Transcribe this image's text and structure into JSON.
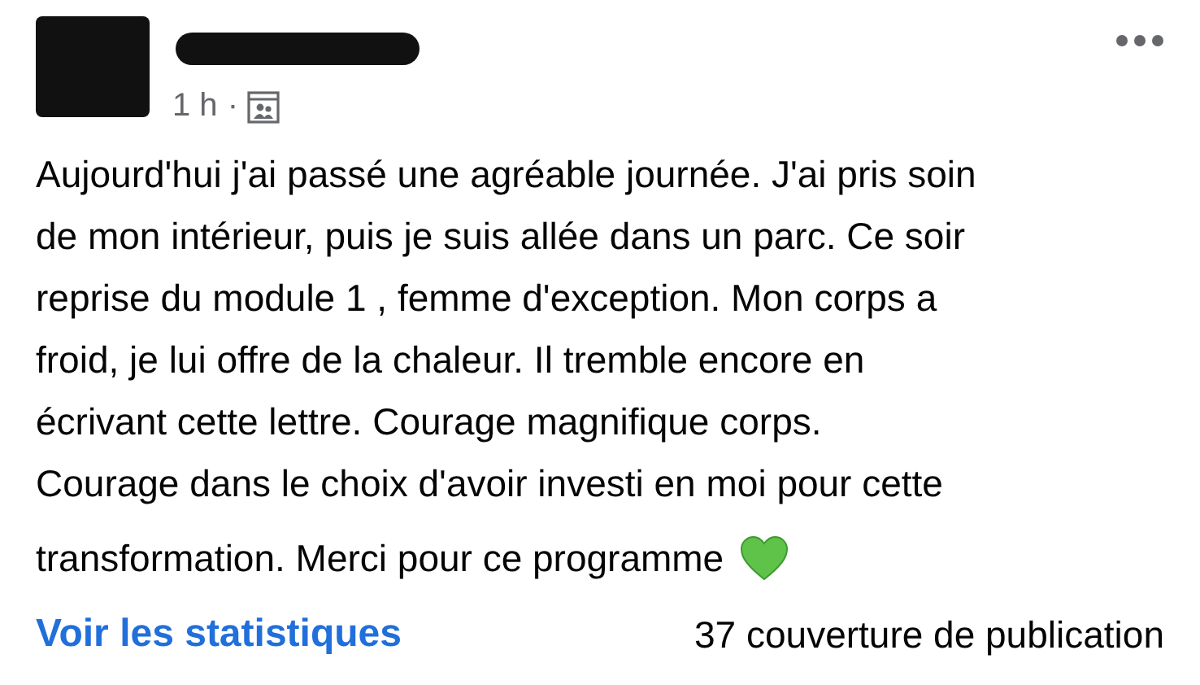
{
  "post": {
    "time": "1 h",
    "separator": "·",
    "lines": [
      "Aujourd'hui j'ai passé une agréable journée. J'ai pris soin",
      "de mon intérieur, puis je suis allée dans un parc. Ce soir",
      "reprise du module 1 , femme d'exception. Mon corps a",
      "froid, je lui offre de la chaleur. Il tremble encore en",
      "écrivant cette lettre. Courage magnifique corps.",
      "Courage dans le choix d'avoir investi en moi pour cette",
      "transformation. Merci pour ce programme"
    ]
  },
  "footer": {
    "link": "Voir les statistiques",
    "reach": "37 couverture de publication"
  }
}
